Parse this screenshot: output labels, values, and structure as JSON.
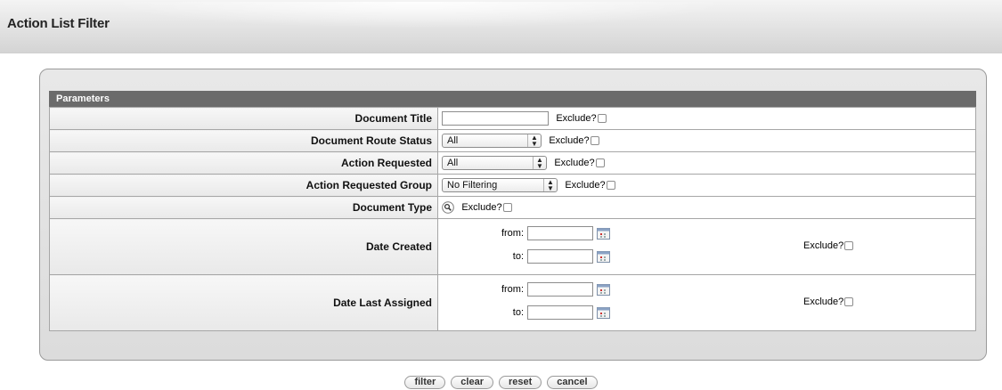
{
  "page": {
    "title": "Action List Filter"
  },
  "section": {
    "title": "Parameters"
  },
  "fields": {
    "document_title": {
      "label": "Document Title",
      "value": "",
      "exclude_label": "Exclude?",
      "exclude_checked": false
    },
    "route_status": {
      "label": "Document Route Status",
      "selected": "All",
      "exclude_label": "Exclude?",
      "exclude_checked": false
    },
    "action_requested": {
      "label": "Action Requested",
      "selected": "All",
      "exclude_label": "Exclude?",
      "exclude_checked": false
    },
    "action_requested_group": {
      "label": "Action Requested Group",
      "selected": "No Filtering",
      "exclude_label": "Exclude?",
      "exclude_checked": false
    },
    "document_type": {
      "label": "Document Type",
      "icon": "magnifier-icon",
      "exclude_label": "Exclude?",
      "exclude_checked": false
    },
    "date_created": {
      "label": "Date Created",
      "from_label": "from:",
      "to_label": "to:",
      "from_value": "",
      "to_value": "",
      "exclude_label": "Exclude?",
      "exclude_checked": false
    },
    "date_last_assigned": {
      "label": "Date Last Assigned",
      "from_label": "from:",
      "to_label": "to:",
      "from_value": "",
      "to_value": "",
      "exclude_label": "Exclude?",
      "exclude_checked": false
    }
  },
  "buttons": {
    "filter": "filter",
    "clear": "clear",
    "reset": "reset",
    "cancel": "cancel"
  },
  "colors": {
    "section_header": "#6b6b6b",
    "panel_bg": "#e2e2e2",
    "border": "#a6a6a6"
  }
}
